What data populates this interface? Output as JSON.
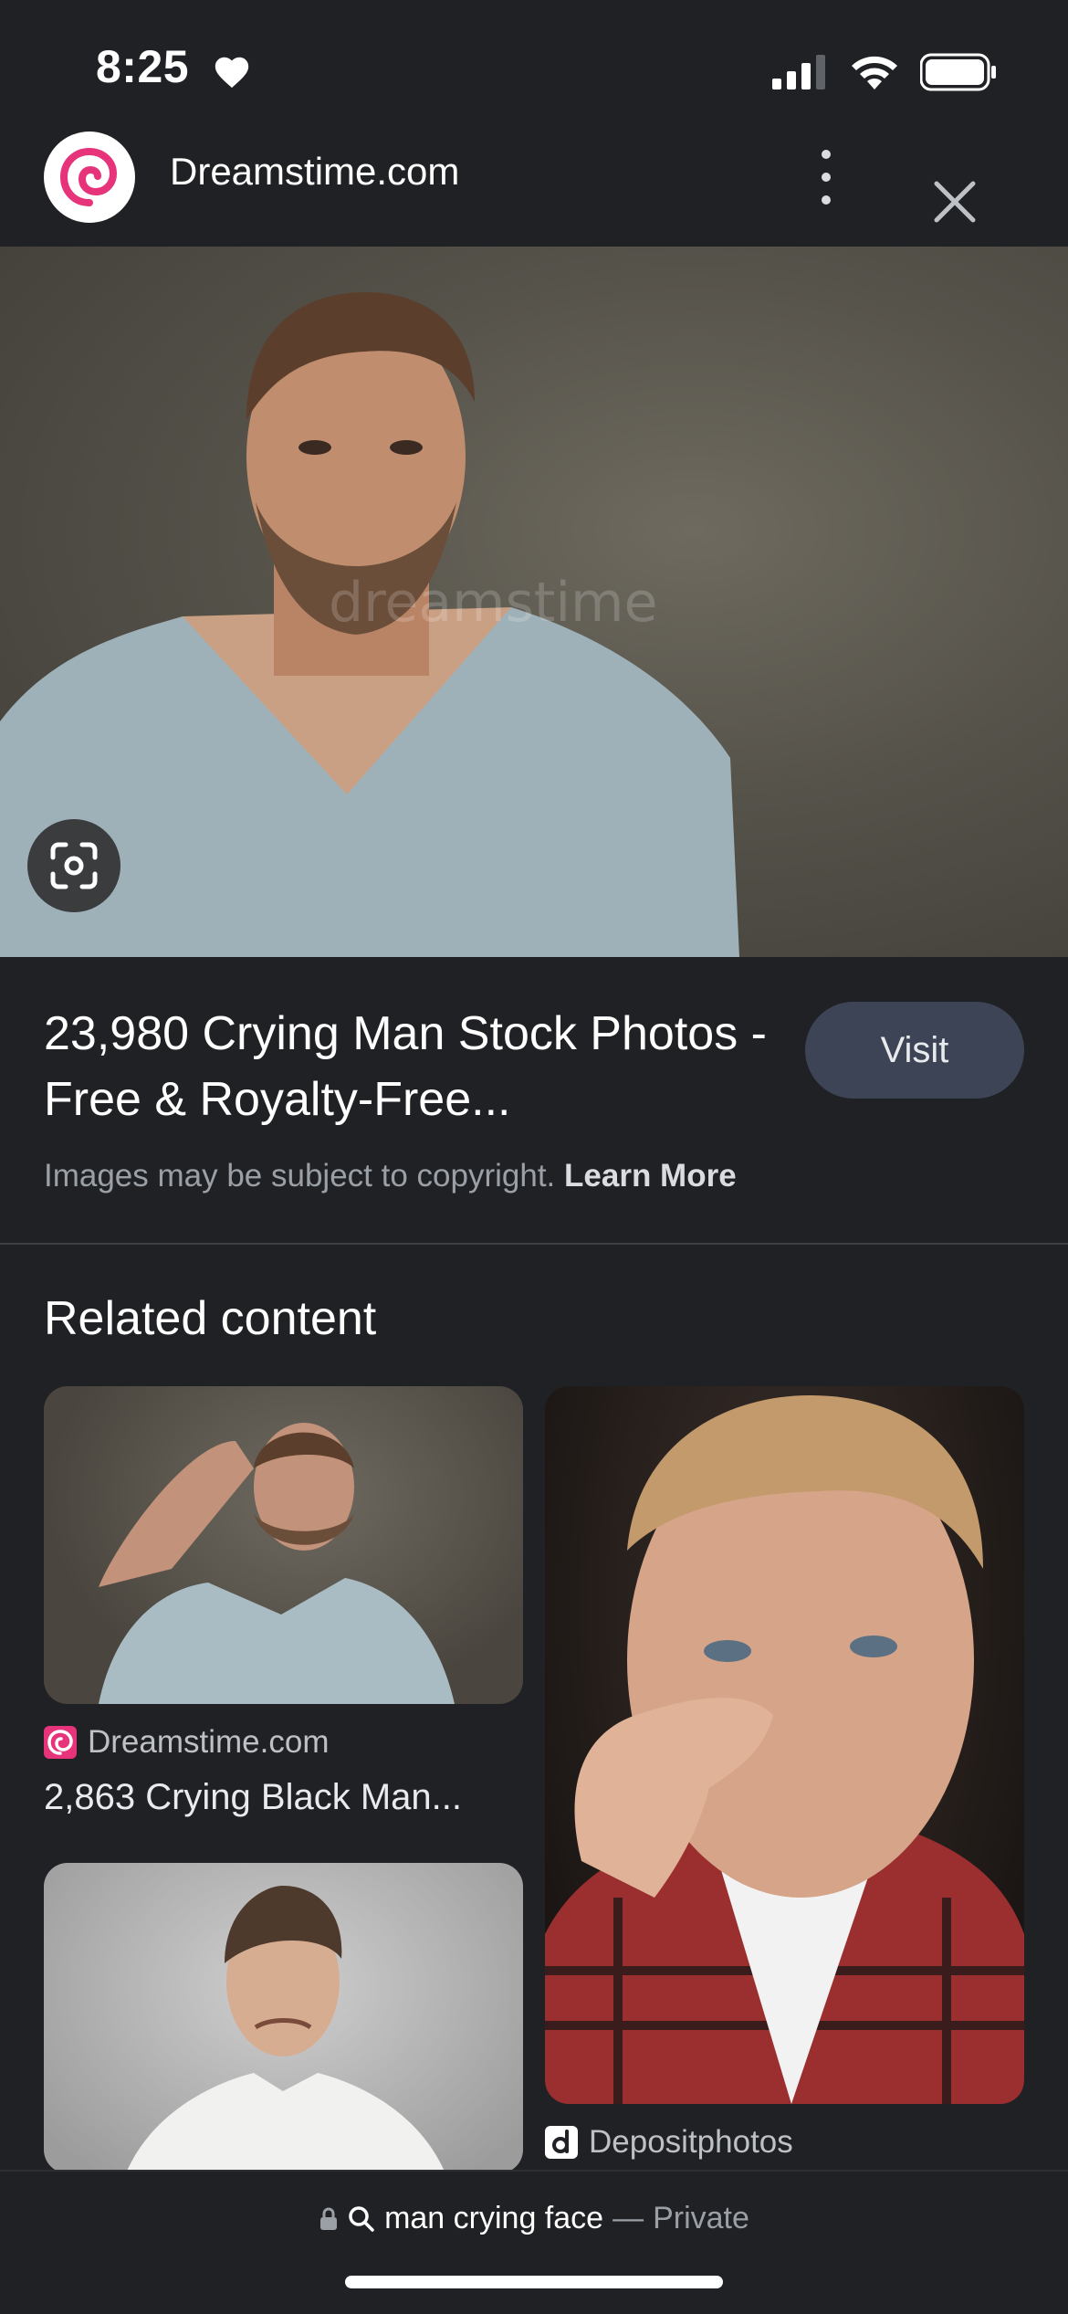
{
  "status_bar": {
    "time": "8:25"
  },
  "header": {
    "site_name": "Dreamstime.com",
    "icons": [
      "dreamstime-logo-icon",
      "more-vert-icon",
      "close-icon"
    ]
  },
  "hero": {
    "watermark": "dreamstime",
    "icons": [
      "google-lens-icon"
    ]
  },
  "result": {
    "title": "23,980 Crying Man Stock Photos - Free & Royalty-Free...",
    "visit_label": "Visit",
    "copyright_text": "Images may be subject to copyright.",
    "learn_more": "Learn More"
  },
  "related": {
    "heading": "Related content",
    "items": [
      {
        "source": "Dreamstime.com",
        "title": "2,863 Crying Black Man..."
      },
      {
        "source": "Depositphotos",
        "title": ""
      },
      {
        "source": "",
        "title": ""
      }
    ]
  },
  "bottom_bar": {
    "query": "man crying face",
    "separator": "—",
    "mode": "Private"
  }
}
